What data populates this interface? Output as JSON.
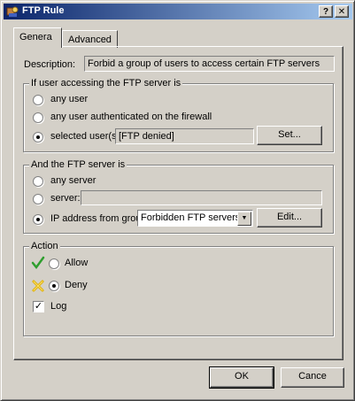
{
  "window": {
    "title": "FTP Rule",
    "help_label": "?",
    "close_label": "✕"
  },
  "tabs": [
    {
      "label": "Genera"
    },
    {
      "label": "Advanced"
    }
  ],
  "description": {
    "label": "Description:",
    "value": "Forbid a group of users to access certain FTP servers"
  },
  "user_group": {
    "legend": "If user accessing the FTP server is",
    "options": [
      {
        "label": "any user",
        "selected": false
      },
      {
        "label": "any user authenticated on the firewall",
        "selected": false
      },
      {
        "label": "selected user(s):",
        "selected": true
      }
    ],
    "selected_users_value": "[FTP denied]",
    "set_button": "Set..."
  },
  "server_group": {
    "legend": "And the FTP server is",
    "options": [
      {
        "label": "any server",
        "selected": false
      },
      {
        "label": "server:",
        "selected": false
      },
      {
        "label": "IP address from group:",
        "selected": true
      }
    ],
    "server_value": "",
    "ip_group_value": "Forbidden FTP servers",
    "edit_button": "Edit..."
  },
  "action_group": {
    "legend": "Action",
    "options": [
      {
        "label": "Allow",
        "selected": false,
        "icon": "check-mark-icon",
        "color": "#2e9e2e"
      },
      {
        "label": "Deny",
        "selected": true,
        "icon": "deny-x-icon",
        "color": "#e0b000"
      }
    ],
    "log_label": "Log",
    "log_checked": true
  },
  "buttons": {
    "ok": "OK",
    "cancel": "Cance"
  }
}
